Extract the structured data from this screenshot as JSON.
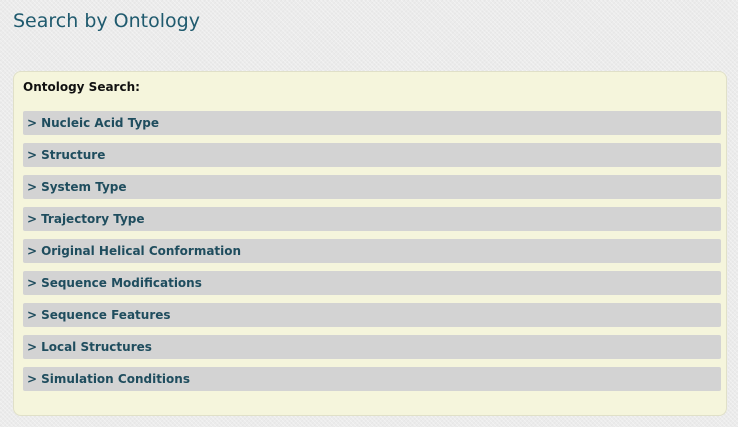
{
  "page": {
    "title": "Search by Ontology"
  },
  "panel": {
    "heading": "Ontology Search:",
    "arrow": ">",
    "categories": [
      {
        "label": "Nucleic Acid Type"
      },
      {
        "label": "Structure"
      },
      {
        "label": "System Type"
      },
      {
        "label": "Trajectory Type"
      },
      {
        "label": "Original Helical Conformation"
      },
      {
        "label": "Sequence Modifications"
      },
      {
        "label": "Sequence Features"
      },
      {
        "label": "Local Structures"
      },
      {
        "label": "Simulation Conditions"
      }
    ]
  },
  "colors": {
    "title_text": "#1f5a6e",
    "panel_background": "#f5f5dc",
    "category_bar": "#d3d3d3",
    "category_text": "#1f4d5e"
  },
  "icons": {
    "expand": "expand-arrow-icon"
  }
}
